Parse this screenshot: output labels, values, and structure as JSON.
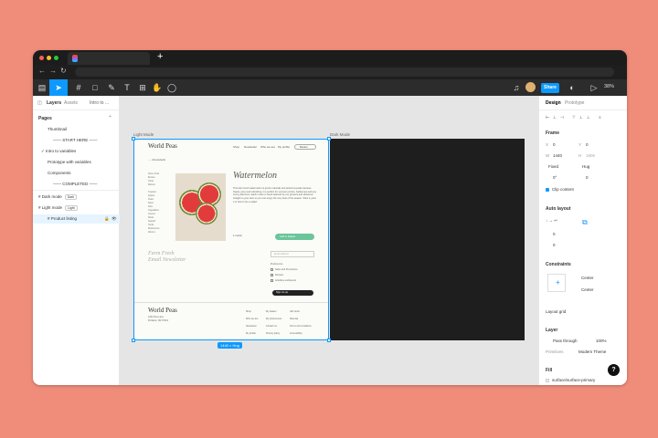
{
  "browser": {
    "tab_title": "",
    "new_tab": "+"
  },
  "toolbar": {
    "share_label": "Share",
    "zoom": "38%"
  },
  "left_panel": {
    "tabs": {
      "layers": "Layers",
      "assets": "Assets",
      "page": "Intro to ..."
    },
    "pages_header": "Pages",
    "pages": [
      "Thumbnail",
      "—— START HERE ——",
      "Intro to variables",
      "Prototype with variables",
      "Components",
      "—— COMPLETED ——"
    ],
    "layers": [
      {
        "label": "Dark mode",
        "badge": "Dark"
      },
      {
        "label": "Light mode",
        "badge": "Light"
      },
      {
        "label": "Product listing",
        "badge": ""
      }
    ]
  },
  "canvas": {
    "light_label": "Light Mode",
    "dark_label": "Dark Mode",
    "size_tag": "1440 × Hug",
    "site": {
      "logo": "World Peas",
      "nav": [
        "Shop",
        "Newsletter",
        "Who we are",
        "My profile"
      ],
      "search": "Basket",
      "back": "← All products",
      "side_links": [
        "Stone fruits",
        "Berries",
        "Citrus",
        "Melons",
        "Tropical",
        "Apples",
        "Pears",
        "Dried",
        "Nuts",
        "Vegetables",
        "Greens",
        "Roots",
        "Squash",
        "Herbs",
        "Mushrooms",
        "Alliums"
      ],
      "product_title": "Watermelon",
      "product_desc": "This farm fresh watermelon is grown naturally and picked at peak ripeness. Sweet, juicy and refreshing, it is perfect for summer picnics, barbecues and any sunny afternoon. Each melon is hand selected by our growers and delivered straight to your door so you can enjoy the very best of the season. Slice it, juice it or toss it into a salad.",
      "qty_label": "1 melon",
      "cart_label": "Add to basket",
      "newsletter_title": [
        "Farm Fresh",
        "Email Newsletter"
      ],
      "email_placeholder": "Email address",
      "pref_label": "Preferences",
      "pref_options": [
        "Sales and Promotions",
        "Recipes",
        "Activities and Events"
      ],
      "signup_label": "Sign me up",
      "footer_logo": "World Peas",
      "footer_address": [
        "1234 Pea Lane",
        "Portland, OR 97201"
      ],
      "footer_col1": [
        "Shop",
        "Who we are",
        "Newsletter",
        "My profile"
      ],
      "footer_col2": [
        "My basket",
        "My preferences",
        "Contact us",
        "Privacy policy"
      ],
      "footer_col3": [
        "Gift cards",
        "Sitemap",
        "Terms and conditions",
        "Accessibility"
      ]
    }
  },
  "right_panel": {
    "tabs": {
      "design": "Design",
      "prototype": "Prototype"
    },
    "frame": {
      "title": "Frame",
      "x": "0",
      "y": "0",
      "w": "1440",
      "h": "1806",
      "w_mode": "Fixed",
      "h_mode": "Hug",
      "rotation": "0°",
      "radius": "0",
      "clip": "Clip content"
    },
    "auto_layout": {
      "title": "Auto layout",
      "gap": "0",
      "padding": "0"
    },
    "constraints": {
      "title": "Constraints",
      "h": "Center",
      "v": "Center"
    },
    "layout_grid": "Layout grid",
    "layer": {
      "title": "Layer",
      "blend": "Pass through",
      "opacity": "100%",
      "primitives_label": "Primitives",
      "theme": "Modern Theme"
    },
    "fill": {
      "title": "Fill",
      "value": "surface/surface-primary"
    },
    "help": "?"
  },
  "colors": {
    "accent": "#0d99ff",
    "backdrop": "#ef8c7a",
    "cart": "#6ac59b"
  }
}
